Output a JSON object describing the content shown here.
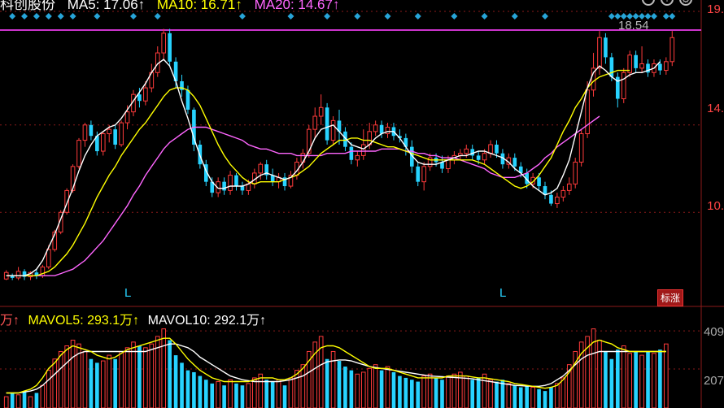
{
  "legend": {
    "stock_name": "科创股份",
    "ma5_label": "MA5: 17.06↑",
    "ma10_label": "MA10: 16.71↑",
    "ma20_label": "MA20: 14.67↑",
    "vol_prefix": "万↑",
    "mavol5_label": "MAVOL5: 293.1万↑",
    "mavol10_label": "MAVOL10: 292.1万↑"
  },
  "axis": {
    "price_ticks": [
      "19.",
      "14.",
      "10."
    ],
    "vol_ticks": [
      "409",
      "207"
    ],
    "high_marker": "18.54"
  },
  "markers": {
    "l_mark": "L",
    "flag_badge": "标涨"
  },
  "icons": [
    "minus-icon",
    "plus-icon",
    "settings-icon"
  ],
  "colors": {
    "up": "#ff3b3b",
    "down": "#27d3ff",
    "ma5": "#ffffff",
    "ma10": "#ffff00",
    "ma20": "#ff66ff",
    "grid": "#8b1a1a",
    "highline": "#cc33cc"
  },
  "chart_data": {
    "type": "candlestick",
    "title": "",
    "price_range": [
      6.9,
      19.4
    ],
    "volume_range": [
      0,
      440
    ],
    "x": [
      1,
      2,
      3,
      4,
      5,
      6,
      7,
      8,
      9,
      10,
      11,
      12,
      13,
      14,
      15,
      16,
      17,
      18,
      19,
      20,
      21,
      22,
      23,
      24,
      25,
      26,
      27,
      28,
      29,
      30,
      31,
      32,
      33,
      34,
      35,
      36,
      37,
      38,
      39,
      40,
      41,
      42,
      43,
      44,
      45,
      46,
      47,
      48,
      49,
      50,
      51,
      52,
      53,
      54,
      55,
      56,
      57,
      58,
      59,
      60,
      61,
      62,
      63,
      64,
      65,
      66,
      67,
      68,
      69,
      70,
      71,
      72,
      73,
      74,
      75,
      76,
      77,
      78,
      79,
      80,
      81,
      82,
      83,
      84,
      85,
      86,
      87,
      88,
      89,
      90,
      91,
      92,
      93,
      94,
      95,
      96,
      97,
      98,
      99,
      100,
      101,
      102,
      103,
      104,
      105,
      106,
      107,
      108,
      109,
      110,
      111,
      112,
      113,
      114,
      115,
      116,
      117,
      118,
      119,
      120,
      121,
      122,
      123,
      124,
      125,
      126,
      127,
      128,
      129,
      130,
      131,
      132,
      133,
      134,
      135,
      136,
      137
    ],
    "candles": [
      [
        7.15,
        7.45,
        7.1,
        7.55
      ],
      [
        7.3,
        7.2,
        7.1,
        7.4
      ],
      [
        7.2,
        7.5,
        7.1,
        7.7
      ],
      [
        7.5,
        7.25,
        7.1,
        7.6
      ],
      [
        7.25,
        7.45,
        7.1,
        7.5
      ],
      [
        7.45,
        7.3,
        7.15,
        7.6
      ],
      [
        7.3,
        7.7,
        7.2,
        7.8
      ],
      [
        7.7,
        8.5,
        7.6,
        8.7
      ],
      [
        8.5,
        9.3,
        8.4,
        9.4
      ],
      [
        9.3,
        10.2,
        9.2,
        10.3
      ],
      [
        10.2,
        11.2,
        10.1,
        11.3
      ],
      [
        11.2,
        12.3,
        11.1,
        12.4
      ],
      [
        12.3,
        13.5,
        12.2,
        13.6
      ],
      [
        13.5,
        14.2,
        13.2,
        14.3
      ],
      [
        14.2,
        13.7,
        13.5,
        14.4
      ],
      [
        13.7,
        13.0,
        12.8,
        13.9
      ],
      [
        13.0,
        13.8,
        12.8,
        13.9
      ],
      [
        13.8,
        14.0,
        13.4,
        14.2
      ],
      [
        14.0,
        13.3,
        13.1,
        14.2
      ],
      [
        13.3,
        14.3,
        13.2,
        14.4
      ],
      [
        14.3,
        14.8,
        14.0,
        15.1
      ],
      [
        14.8,
        15.6,
        14.6,
        15.8
      ],
      [
        15.6,
        15.3,
        15.0,
        15.9
      ],
      [
        15.3,
        15.9,
        15.1,
        16.2
      ],
      [
        15.9,
        16.6,
        15.7,
        17.0
      ],
      [
        16.6,
        17.5,
        16.4,
        17.8
      ],
      [
        17.5,
        18.4,
        17.2,
        18.6
      ],
      [
        18.4,
        17.1,
        16.9,
        18.6
      ],
      [
        17.1,
        16.2,
        15.9,
        17.3
      ],
      [
        16.2,
        15.8,
        15.5,
        16.5
      ],
      [
        15.8,
        14.9,
        14.7,
        16.0
      ],
      [
        14.9,
        13.3,
        13.0,
        15.0
      ],
      [
        13.3,
        12.4,
        12.2,
        13.5
      ],
      [
        12.4,
        11.6,
        11.4,
        12.6
      ],
      [
        11.6,
        11.1,
        10.9,
        11.8
      ],
      [
        11.1,
        11.6,
        10.9,
        11.8
      ],
      [
        11.6,
        11.2,
        11.0,
        11.8
      ],
      [
        11.2,
        11.9,
        11.0,
        12.1
      ],
      [
        11.9,
        11.4,
        11.2,
        12.0
      ],
      [
        11.4,
        11.2,
        11.0,
        11.6
      ],
      [
        11.2,
        11.5,
        11.0,
        11.7
      ],
      [
        11.5,
        12.0,
        11.3,
        12.2
      ],
      [
        12.0,
        12.4,
        11.7,
        12.5
      ],
      [
        12.4,
        11.9,
        11.7,
        12.6
      ],
      [
        11.9,
        11.6,
        11.4,
        12.2
      ],
      [
        11.6,
        11.8,
        11.3,
        12.0
      ],
      [
        11.8,
        11.4,
        11.2,
        12.0
      ],
      [
        11.4,
        11.9,
        11.3,
        12.1
      ],
      [
        11.9,
        12.5,
        11.7,
        12.7
      ],
      [
        12.5,
        12.9,
        12.2,
        13.1
      ],
      [
        12.9,
        14.0,
        12.7,
        14.2
      ],
      [
        14.0,
        14.6,
        13.6,
        15.0
      ],
      [
        14.6,
        15.0,
        14.2,
        15.6
      ],
      [
        15.0,
        13.5,
        13.3,
        15.2
      ],
      [
        13.5,
        14.4,
        13.3,
        14.6
      ],
      [
        14.4,
        13.9,
        13.3,
        14.9
      ],
      [
        13.9,
        13.2,
        13.0,
        14.1
      ],
      [
        13.2,
        12.6,
        12.4,
        13.4
      ],
      [
        12.6,
        12.8,
        12.3,
        13.0
      ],
      [
        12.8,
        13.3,
        12.6,
        14.0
      ],
      [
        13.3,
        13.9,
        13.1,
        14.3
      ],
      [
        13.9,
        14.2,
        13.7,
        14.4
      ],
      [
        14.2,
        13.8,
        13.6,
        14.4
      ],
      [
        13.8,
        14.1,
        13.6,
        14.3
      ],
      [
        14.1,
        13.7,
        13.5,
        14.3
      ],
      [
        13.7,
        13.6,
        13.4,
        14.0
      ],
      [
        13.6,
        13.2,
        12.8,
        13.8
      ],
      [
        13.2,
        12.3,
        12.0,
        13.5
      ],
      [
        12.3,
        11.6,
        11.4,
        12.5
      ],
      [
        11.6,
        12.3,
        11.2,
        12.5
      ],
      [
        12.3,
        12.7,
        12.1,
        12.9
      ],
      [
        12.7,
        12.5,
        12.3,
        12.9
      ],
      [
        12.5,
        12.2,
        12.0,
        12.8
      ],
      [
        12.2,
        12.6,
        12.0,
        12.8
      ],
      [
        12.6,
        12.8,
        12.4,
        13.0
      ],
      [
        12.8,
        12.9,
        12.6,
        13.1
      ],
      [
        12.9,
        13.1,
        12.7,
        13.3
      ],
      [
        13.1,
        12.8,
        12.6,
        13.3
      ],
      [
        12.8,
        12.6,
        12.4,
        13.0
      ],
      [
        12.6,
        12.9,
        12.4,
        13.1
      ],
      [
        12.9,
        13.3,
        12.7,
        13.5
      ],
      [
        13.3,
        12.9,
        12.7,
        13.5
      ],
      [
        12.9,
        12.4,
        12.2,
        13.1
      ],
      [
        12.4,
        12.7,
        12.2,
        12.9
      ],
      [
        12.7,
        12.3,
        12.1,
        12.9
      ],
      [
        12.3,
        12.0,
        11.8,
        12.5
      ],
      [
        12.0,
        11.5,
        11.3,
        12.2
      ],
      [
        11.5,
        11.8,
        11.3,
        12.0
      ],
      [
        11.8,
        11.4,
        11.2,
        12.0
      ],
      [
        11.4,
        11.0,
        10.8,
        11.6
      ],
      [
        11.0,
        10.6,
        10.5,
        11.2
      ],
      [
        10.6,
        10.9,
        10.4,
        11.1
      ],
      [
        10.9,
        11.2,
        10.7,
        11.4
      ],
      [
        11.2,
        11.5,
        11.0,
        11.8
      ],
      [
        11.5,
        12.5,
        11.3,
        12.7
      ],
      [
        12.5,
        13.8,
        12.3,
        14.0
      ],
      [
        13.8,
        15.8,
        13.6,
        16.2
      ],
      [
        15.8,
        16.8,
        15.5,
        17.5
      ],
      [
        16.8,
        18.2,
        16.5,
        18.5
      ],
      [
        18.2,
        17.3,
        17.0,
        18.4
      ],
      [
        17.3,
        16.4,
        16.2,
        17.5
      ],
      [
        16.4,
        15.4,
        15.0,
        16.6
      ],
      [
        15.4,
        16.6,
        15.2,
        16.8
      ],
      [
        16.6,
        17.4,
        16.4,
        17.6
      ],
      [
        17.4,
        16.8,
        16.6,
        17.6
      ],
      [
        16.8,
        17.0,
        16.6,
        17.8
      ],
      [
        17.0,
        16.6,
        16.4,
        17.2
      ],
      [
        16.6,
        17.0,
        16.4,
        17.2
      ],
      [
        17.0,
        16.7,
        16.5,
        17.2
      ],
      [
        16.7,
        17.1,
        16.5,
        17.3
      ],
      [
        17.1,
        18.2,
        16.9,
        18.5
      ]
    ],
    "ma5": [
      7.3,
      7.3,
      7.3,
      7.3,
      7.4,
      7.6,
      8.0,
      8.6,
      9.2,
      9.9,
      10.6,
      11.3,
      12.1,
      12.8,
      13.3,
      13.7,
      13.9,
      14.1,
      14.2,
      14.5,
      14.9,
      15.3,
      15.7,
      16.1,
      16.6,
      17.0,
      17.2,
      16.9,
      16.2,
      15.3,
      14.5,
      13.6,
      12.8,
      12.1,
      11.6,
      11.3,
      11.3,
      11.4,
      11.4,
      11.4,
      11.5,
      11.7,
      11.9,
      12.0,
      11.9,
      11.8,
      11.7,
      11.8,
      12.1,
      12.5,
      13.0,
      13.6,
      14.0,
      14.1,
      14.2,
      13.9,
      13.6,
      13.3,
      13.2,
      13.1,
      13.3,
      13.6,
      13.8,
      13.9,
      13.9,
      13.6,
      13.2,
      12.8,
      12.5,
      12.4,
      12.4,
      12.4,
      12.5,
      12.6,
      12.7,
      12.8,
      12.8,
      12.9,
      13.0,
      13.0,
      12.9,
      12.8,
      12.7,
      12.5,
      12.2,
      12.0,
      11.7,
      11.4,
      11.2,
      11.0,
      11.1,
      11.3,
      11.9,
      12.6,
      13.7,
      14.8,
      15.9,
      16.6,
      16.9,
      16.7,
      16.4,
      16.2,
      16.3,
      16.5,
      16.6,
      16.6,
      16.7,
      16.8,
      17.1
    ],
    "ma10": [
      7.3,
      7.3,
      7.3,
      7.3,
      7.3,
      7.3,
      7.4,
      7.5,
      7.7,
      8.0,
      8.3,
      8.7,
      9.2,
      9.7,
      10.3,
      10.9,
      11.4,
      11.9,
      12.3,
      12.8,
      13.2,
      13.6,
      14.0,
      14.3,
      14.7,
      15.1,
      15.5,
      15.8,
      15.9,
      15.9,
      15.8,
      15.5,
      15.1,
      14.5,
      13.9,
      13.3,
      12.8,
      12.4,
      12.1,
      11.8,
      11.6,
      11.5,
      11.6,
      11.6,
      11.6,
      11.6,
      11.7,
      11.8,
      11.9,
      12.1,
      12.3,
      12.6,
      12.9,
      13.1,
      13.3,
      13.5,
      13.5,
      13.6,
      13.6,
      13.5,
      13.5,
      13.4,
      13.3,
      13.2,
      13.2,
      13.1,
      13.0,
      12.9,
      12.8,
      12.7,
      12.6,
      12.6,
      12.6,
      12.6,
      12.6,
      12.6,
      12.6,
      12.6,
      12.5,
      12.4,
      12.2,
      12.0,
      11.8,
      11.6,
      11.4,
      11.3,
      11.4,
      11.6,
      11.9,
      12.3,
      12.7,
      13.3,
      13.9,
      14.4,
      15.0,
      15.4,
      15.9,
      16.2,
      16.4,
      16.5,
      16.6,
      16.7,
      16.7,
      16.7
    ],
    "ma20": [
      7.3,
      7.3,
      7.3,
      7.3,
      7.3,
      7.3,
      7.3,
      7.3,
      7.3,
      7.4,
      7.5,
      7.6,
      7.8,
      8.0,
      8.3,
      8.6,
      8.9,
      9.3,
      9.7,
      10.1,
      10.5,
      11.0,
      11.4,
      11.9,
      12.3,
      12.7,
      13.1,
      13.4,
      13.6,
      13.8,
      14.0,
      14.1,
      14.1,
      14.1,
      14.0,
      13.9,
      13.8,
      13.7,
      13.6,
      13.5,
      13.3,
      13.2,
      13.1,
      13.1,
      13.0,
      12.9,
      12.9,
      12.9,
      12.8,
      12.8,
      12.8,
      12.8,
      12.8,
      12.9,
      12.9,
      12.9,
      12.9,
      13.0,
      13.0,
      13.0,
      13.0,
      13.0,
      13.1,
      13.1,
      13.1,
      13.1,
      13.0,
      13.0,
      12.9,
      12.9,
      12.8,
      12.8,
      12.7,
      12.7,
      12.7,
      12.6,
      12.5,
      12.4,
      12.3,
      12.2,
      12.0,
      11.9,
      11.8,
      11.8,
      11.8,
      11.9,
      12.0,
      12.2,
      12.4,
      12.7,
      12.9,
      13.2,
      13.4,
      13.6,
      13.8,
      14.0,
      14.2,
      14.4,
      14.6
    ],
    "volume": [
      60,
      80,
      70,
      90,
      60,
      80,
      120,
      200,
      260,
      300,
      330,
      360,
      340,
      300,
      260,
      240,
      250,
      280,
      260,
      300,
      320,
      350,
      330,
      320,
      340,
      380,
      420,
      360,
      280,
      240,
      200,
      190,
      170,
      150,
      130,
      140,
      120,
      150,
      130,
      120,
      130,
      160,
      180,
      150,
      140,
      150,
      120,
      160,
      200,
      230,
      300,
      350,
      380,
      260,
      300,
      250,
      220,
      200,
      180,
      190,
      210,
      230,
      200,
      220,
      190,
      170,
      160,
      150,
      140,
      170,
      180,
      160,
      150,
      170,
      180,
      190,
      170,
      150,
      160,
      180,
      150,
      140,
      150,
      130,
      120,
      110,
      120,
      110,
      100,
      90,
      110,
      130,
      160,
      230,
      300,
      350,
      380,
      420,
      360,
      300,
      260,
      310,
      330,
      290,
      300,
      280,
      300,
      290,
      310,
      340
    ],
    "mavol5": [
      80,
      80,
      80,
      90,
      100,
      120,
      160,
      210,
      240,
      280,
      310,
      330,
      320,
      310,
      300,
      280,
      270,
      260,
      270,
      290,
      310,
      320,
      330,
      340,
      350,
      360,
      370,
      370,
      340,
      300,
      260,
      230,
      200,
      180,
      160,
      150,
      140,
      140,
      140,
      140,
      140,
      150,
      160,
      160,
      160,
      150,
      150,
      160,
      180,
      210,
      250,
      290,
      320,
      330,
      330,
      320,
      300,
      280,
      260,
      240,
      220,
      210,
      210,
      210,
      200,
      190,
      180,
      170,
      160,
      160,
      160,
      160,
      160,
      170,
      170,
      170,
      170,
      165,
      160,
      160,
      155,
      150,
      145,
      140,
      130,
      125,
      120,
      115,
      110,
      105,
      110,
      120,
      150,
      190,
      240,
      290,
      320,
      350,
      360,
      350,
      340,
      320,
      310,
      300,
      300,
      300,
      300,
      300,
      300,
      300
    ],
    "mavol10": [
      80,
      80,
      80,
      85,
      90,
      100,
      120,
      150,
      180,
      210,
      240,
      270,
      290,
      300,
      300,
      300,
      300,
      300,
      300,
      300,
      300,
      300,
      300,
      300,
      310,
      320,
      330,
      340,
      340,
      330,
      320,
      300,
      270,
      250,
      230,
      210,
      190,
      170,
      160,
      150,
      145,
      140,
      140,
      140,
      140,
      140,
      145,
      150,
      160,
      170,
      190,
      210,
      230,
      245,
      250,
      255,
      255,
      250,
      240,
      230,
      220,
      215,
      210,
      205,
      200,
      195,
      190,
      185,
      180,
      175,
      170,
      168,
      166,
      164,
      162,
      160,
      158,
      155,
      150,
      145,
      140,
      135,
      130,
      125,
      120,
      118,
      116,
      115,
      115,
      120,
      130,
      150,
      170,
      200,
      230,
      260,
      280,
      290,
      300,
      300,
      300,
      300,
      300,
      300,
      300,
      300,
      300,
      300,
      300,
      300
    ]
  }
}
